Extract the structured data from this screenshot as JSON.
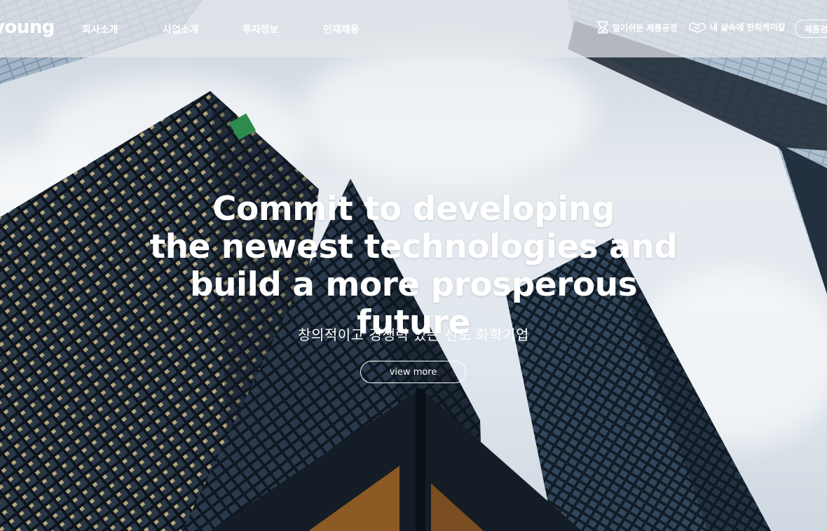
{
  "brand": {
    "logo_text": "young"
  },
  "nav": {
    "items": [
      {
        "label": "회사소개"
      },
      {
        "label": "사업소개"
      },
      {
        "label": "투자정보"
      },
      {
        "label": "인재채용"
      }
    ]
  },
  "utility": {
    "process_link": {
      "label": "알기쉬운 제품공정",
      "icon": "hourglass-icon"
    },
    "life_link": {
      "label": "내 삶속에 한화케미칼",
      "icon": "handshake-icon"
    },
    "products_button": {
      "label": "제품검"
    }
  },
  "hero": {
    "headline": [
      "Commit to developing",
      "the newest technologies and",
      "build a more prosperous future"
    ],
    "subhead": "창의적이고 경쟁력 있는 선도 화학기업",
    "cta_label": "view more"
  },
  "colors": {
    "header_overlay": "#e6e8ec",
    "text": "#ffffff",
    "building_glass": "#1c2836"
  }
}
